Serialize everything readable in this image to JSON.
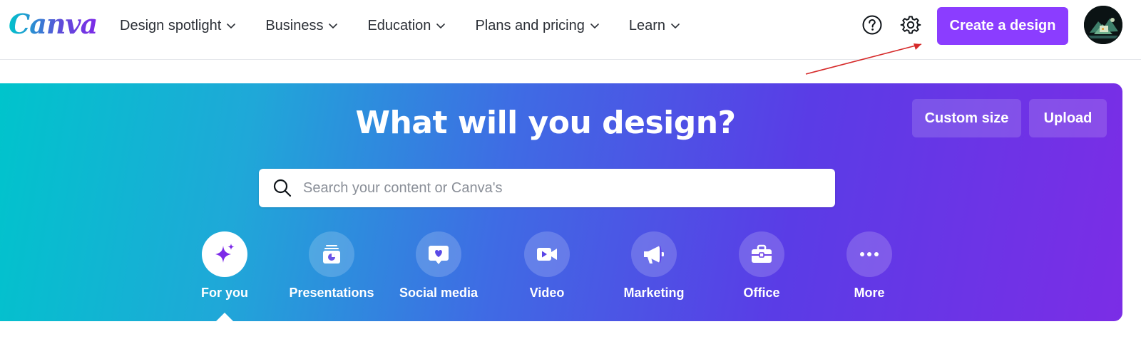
{
  "header": {
    "logo_text": "Canva",
    "nav_items": [
      {
        "label": "Design spotlight"
      },
      {
        "label": "Business"
      },
      {
        "label": "Education"
      },
      {
        "label": "Plans and pricing"
      },
      {
        "label": "Learn"
      }
    ],
    "help_icon": "question-circle-icon",
    "settings_icon": "gear-icon",
    "create_button": "Create a design",
    "accent_color": "#8b3dff"
  },
  "annotation": {
    "arrow_color": "#d62b2b",
    "points_to": "create-design-button"
  },
  "hero": {
    "title": "What will you design?",
    "custom_size": "Custom size",
    "upload": "Upload",
    "search": {
      "placeholder": "Search your content or Canva's",
      "value": ""
    },
    "gradient_colors": [
      "#00c4cc",
      "#3f6be4",
      "#7b2de6"
    ],
    "categories": [
      {
        "label": "For you",
        "icon": "sparkle-icon",
        "active": true
      },
      {
        "label": "Presentations",
        "icon": "presentation-icon",
        "active": false
      },
      {
        "label": "Social media",
        "icon": "heart-chat-icon",
        "active": false
      },
      {
        "label": "Video",
        "icon": "video-camera-icon",
        "active": false
      },
      {
        "label": "Marketing",
        "icon": "megaphone-icon",
        "active": false
      },
      {
        "label": "Office",
        "icon": "briefcase-icon",
        "active": false
      },
      {
        "label": "More",
        "icon": "more-dots-icon",
        "active": false
      }
    ]
  }
}
